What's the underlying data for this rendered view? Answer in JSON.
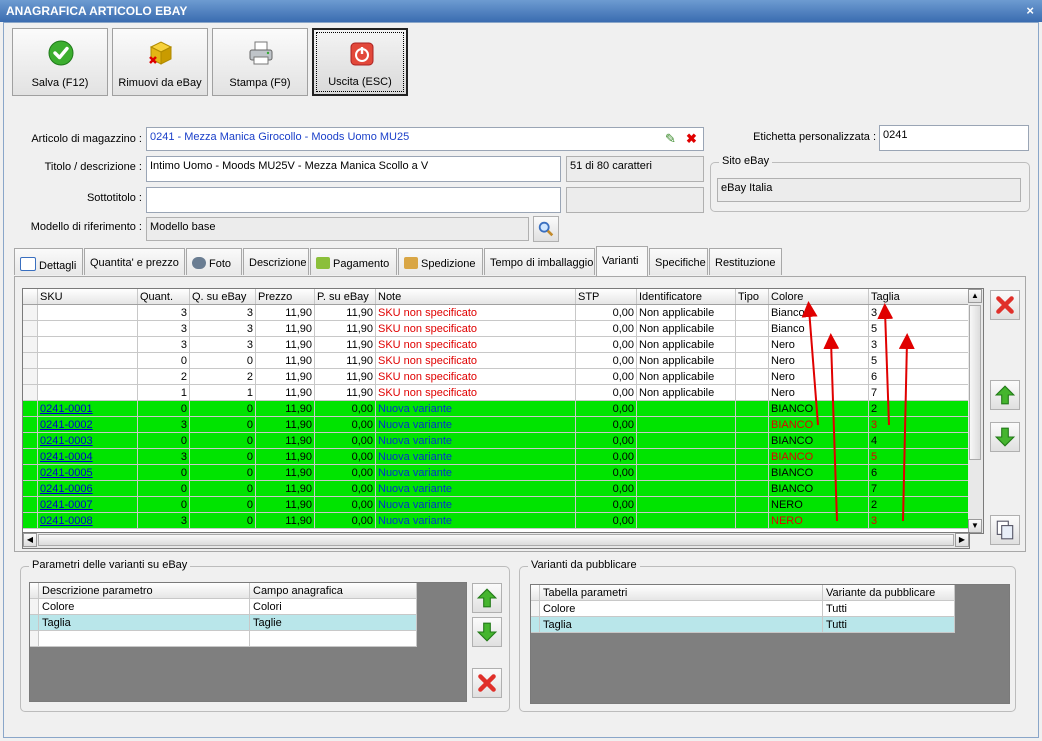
{
  "window": {
    "title": "ANAGRAFICA ARTICOLO EBAY",
    "close": "×"
  },
  "toolbar": [
    {
      "label": "Salva (F12)",
      "icon": "check-icon"
    },
    {
      "label": "Rimuovi da eBay",
      "icon": "box-remove-icon"
    },
    {
      "label": "Stampa (F9)",
      "icon": "printer-icon"
    },
    {
      "label": "Uscita (ESC)",
      "icon": "power-icon"
    }
  ],
  "form": {
    "articolo_label": "Articolo di magazzino :",
    "articolo_value": "0241 - Mezza Manica Girocollo - Moods Uomo MU25",
    "titolo_label": "Titolo / descrizione :",
    "titolo_value": "Intimo Uomo - Moods MU25V - Mezza Manica Scollo a V",
    "char_count": "51 di 80 caratteri",
    "sottotitolo_label": "Sottotitolo :",
    "sottotitolo_value": "",
    "modello_label": "Modello di riferimento :",
    "modello_value": "Modello base",
    "etichetta_label": "Etichetta personalizzata :",
    "etichetta_value": "0241",
    "sito_label": "Sito eBay",
    "sito_value": "eBay Italia"
  },
  "tabs": [
    "Dettagli",
    "Quantita' e prezzo",
    "Foto",
    "Descrizione",
    "Pagamento",
    "Spedizione",
    "Tempo di imballaggio",
    "Varianti",
    "Specifiche",
    "Restituzione"
  ],
  "active_tab": "Varianti",
  "variants": {
    "columns": [
      "SKU",
      "Quant.",
      "Q. su eBay",
      "Prezzo",
      "P. su eBay",
      "Note",
      "STP",
      "Identificatore",
      "Tipo",
      "Colore",
      "Taglia"
    ],
    "rows": [
      [
        "",
        "3",
        "3",
        "11,90",
        "11,90",
        "SKU non specificato",
        "0,00",
        "Non applicabile",
        "",
        "Bianco",
        "3"
      ],
      [
        "",
        "3",
        "3",
        "11,90",
        "11,90",
        "SKU non specificato",
        "0,00",
        "Non applicabile",
        "",
        "Bianco",
        "5"
      ],
      [
        "",
        "3",
        "3",
        "11,90",
        "11,90",
        "SKU non specificato",
        "0,00",
        "Non applicabile",
        "",
        "Nero",
        "3"
      ],
      [
        "",
        "0",
        "0",
        "11,90",
        "11,90",
        "SKU non specificato",
        "0,00",
        "Non applicabile",
        "",
        "Nero",
        "5"
      ],
      [
        "",
        "2",
        "2",
        "11,90",
        "11,90",
        "SKU non specificato",
        "0,00",
        "Non applicabile",
        "",
        "Nero",
        "6"
      ],
      [
        "",
        "1",
        "1",
        "11,90",
        "11,90",
        "SKU non specificato",
        "0,00",
        "Non applicabile",
        "",
        "Nero",
        "7"
      ],
      [
        "0241-0001",
        "0",
        "0",
        "11,90",
        "0,00",
        "Nuova variante",
        "0,00",
        "",
        "",
        "BIANCO",
        "2"
      ],
      [
        "0241-0002",
        "3",
        "0",
        "11,90",
        "0,00",
        "Nuova variante",
        "0,00",
        "",
        "",
        "BIANCO",
        "3"
      ],
      [
        "0241-0003",
        "0",
        "0",
        "11,90",
        "0,00",
        "Nuova variante",
        "0,00",
        "",
        "",
        "BIANCO",
        "4"
      ],
      [
        "0241-0004",
        "3",
        "0",
        "11,90",
        "0,00",
        "Nuova variante",
        "0,00",
        "",
        "",
        "BIANCO",
        "5"
      ],
      [
        "0241-0005",
        "0",
        "0",
        "11,90",
        "0,00",
        "Nuova variante",
        "0,00",
        "",
        "",
        "BIANCO",
        "6"
      ],
      [
        "0241-0006",
        "0",
        "0",
        "11,90",
        "0,00",
        "Nuova variante",
        "0,00",
        "",
        "",
        "BIANCO",
        "7"
      ],
      [
        "0241-0007",
        "0",
        "0",
        "11,90",
        "0,00",
        "Nuova variante",
        "0,00",
        "",
        "",
        "NERO",
        "2"
      ],
      [
        "0241-0008",
        "3",
        "0",
        "11,90",
        "0,00",
        "Nuova variante",
        "0,00",
        "",
        "",
        "NERO",
        "3"
      ]
    ],
    "highlight_color": "#00e400",
    "warning_color": "#e00000"
  },
  "params": {
    "title": "Parametri delle varianti su eBay",
    "columns": [
      "Descrizione parametro",
      "Campo anagrafica"
    ],
    "rows": [
      [
        "Colore",
        "Colori"
      ],
      [
        "Taglia",
        "Taglie"
      ],
      [
        "",
        ""
      ]
    ]
  },
  "publish": {
    "title": "Varianti da pubblicare",
    "columns": [
      "Tabella parametri",
      "Variante da pubblicare"
    ],
    "rows": [
      [
        "Colore",
        "Tutti"
      ],
      [
        "Taglia",
        "Tutti"
      ]
    ]
  }
}
